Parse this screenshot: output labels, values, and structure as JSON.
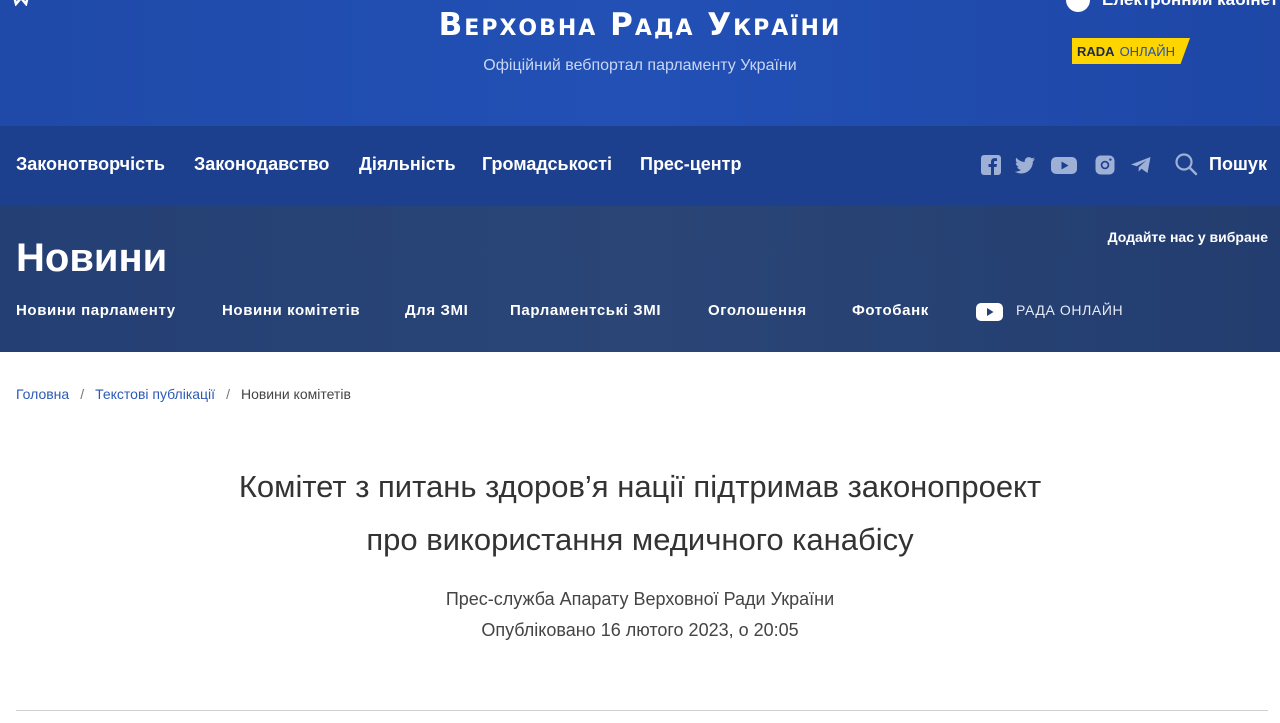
{
  "header": {
    "title": "Верховна Рада України",
    "subtitle": "Офіційний вебпортал парламенту України",
    "cabinet_label": "Електронний кабінет",
    "rada_badge": {
      "bold": "RADA",
      "light": "ОНЛАЙН",
      "color": "#ffd500"
    }
  },
  "main_nav": {
    "items": [
      "Законотворчість",
      "Законодавство",
      "Діяльність",
      "Громадськості",
      "Прес-центр"
    ],
    "social_icons": [
      "facebook-icon",
      "twitter-icon",
      "youtube-icon",
      "instagram-icon",
      "telegram-icon"
    ],
    "search_label": "Пошук"
  },
  "news": {
    "title": "Новини",
    "favorites_label": "Додайте нас у вибране",
    "sub_items": [
      "Новини парламенту",
      "Новини комітетів",
      "Для ЗМІ",
      "Парламентські ЗМІ",
      "Оголошення",
      "Фотобанк"
    ],
    "rada_online_label": "РАДА ОНЛАЙН"
  },
  "breadcrumb": {
    "home": "Головна",
    "section": "Текстові публікації",
    "current": "Новини комітетів",
    "separator": "/"
  },
  "article": {
    "title_line1": "Комітет з питань здоров’я нації підтримав законопроект",
    "title_line2": "про використання медичного канабісу",
    "author": "Прес-служба Апарату Верховної Ради України",
    "published": "Опубліковано 16 лютого 2023, о 20:05"
  },
  "colors": {
    "header_blue": "#2250b5",
    "nav_blue": "#1c3f8e",
    "band_navy": "#243f74",
    "link_blue": "#2b5ab5"
  }
}
